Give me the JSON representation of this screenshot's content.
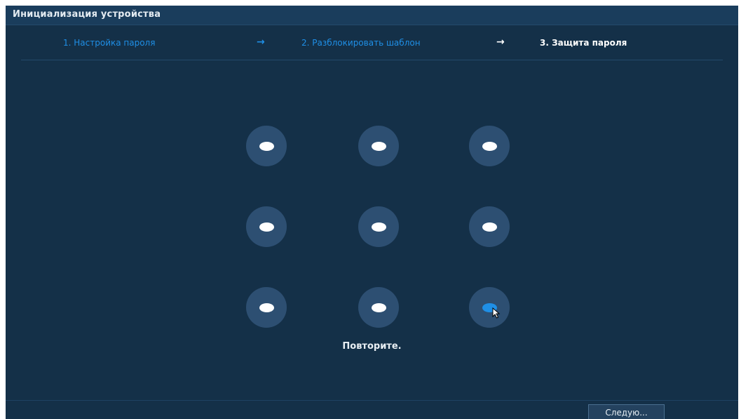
{
  "window": {
    "title": "Инициализация устройства"
  },
  "steps": [
    {
      "label": "1.  Настройка пароля",
      "state": "done"
    },
    {
      "label": "2.  Разблокировать шаблон",
      "state": "done"
    },
    {
      "label": "3.  Защита пароля",
      "state": "current"
    }
  ],
  "arrows": [
    "→",
    "→"
  ],
  "pattern": {
    "dots": [
      {
        "id": 1,
        "active": false
      },
      {
        "id": 2,
        "active": false
      },
      {
        "id": 3,
        "active": false
      },
      {
        "id": 4,
        "active": false
      },
      {
        "id": 5,
        "active": false
      },
      {
        "id": 6,
        "active": false
      },
      {
        "id": 7,
        "active": false
      },
      {
        "id": 8,
        "active": false
      },
      {
        "id": 9,
        "active": true
      }
    ],
    "message": "Повторите."
  },
  "footer": {
    "next_label": "Следую..."
  },
  "colors": {
    "background": "#143048",
    "titlebar": "#1a3d5c",
    "accent": "#1f8fe6",
    "dot_outer": "#2d4f72",
    "dot_inner": "#ffffff"
  }
}
